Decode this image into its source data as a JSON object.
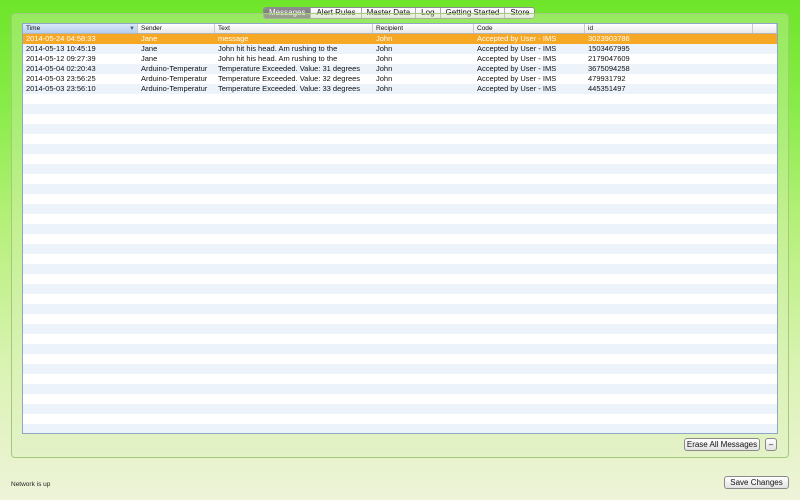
{
  "tabs": [
    {
      "label": "Messages",
      "active": true
    },
    {
      "label": "Alert Rules",
      "active": false
    },
    {
      "label": "Master Data",
      "active": false
    },
    {
      "label": "Log",
      "active": false
    },
    {
      "label": "Getting Started",
      "active": false
    },
    {
      "label": "Store",
      "active": false
    }
  ],
  "table": {
    "columns": [
      "Time",
      "Sender",
      "Text",
      "Recipient",
      "Code",
      "id"
    ],
    "sorted_column": "Time",
    "rows": [
      {
        "time": "2014-05-24 04:58:33",
        "sender": "Jane",
        "text": "message",
        "recipient": "John",
        "code": "Accepted by User - IMS",
        "id": "3023903786",
        "selected": true
      },
      {
        "time": "2014-05-13 10:45:19",
        "sender": "Jane",
        "text": "John hit his head. Am rushing to the",
        "recipient": "John",
        "code": "Accepted by User - IMS",
        "id": "1503467995",
        "selected": false
      },
      {
        "time": "2014-05-12 09:27:39",
        "sender": "Jane",
        "text": "John hit his head. Am rushing to the",
        "recipient": "John",
        "code": "Accepted by User - IMS",
        "id": "2179047609",
        "selected": false
      },
      {
        "time": "2014-05-04 02:20:43",
        "sender": "Arduino-Temperatur",
        "text": "Temperature Exceeded. Value: 31 degrees",
        "recipient": "John",
        "code": "Accepted by User - IMS",
        "id": "3675094258",
        "selected": false
      },
      {
        "time": "2014-05-03 23:56:25",
        "sender": "Arduino-Temperatur",
        "text": "Temperature Exceeded. Value: 32 degrees",
        "recipient": "John",
        "code": "Accepted by User - IMS",
        "id": "479931792",
        "selected": false
      },
      {
        "time": "2014-05-03 23:56:10",
        "sender": "Arduino-Temperatur",
        "text": "Temperature Exceeded. Value: 33 degrees",
        "recipient": "John",
        "code": "Accepted by User - IMS",
        "id": "445351497",
        "selected": false
      }
    ]
  },
  "buttons": {
    "erase_all": "Erase All Messages",
    "remove": "–",
    "save_changes": "Save Changes"
  },
  "status": "Network is up",
  "colors": {
    "selection": "#f6a723",
    "bg_top": "#6ee52a",
    "bg_bottom": "#eef3d9"
  }
}
